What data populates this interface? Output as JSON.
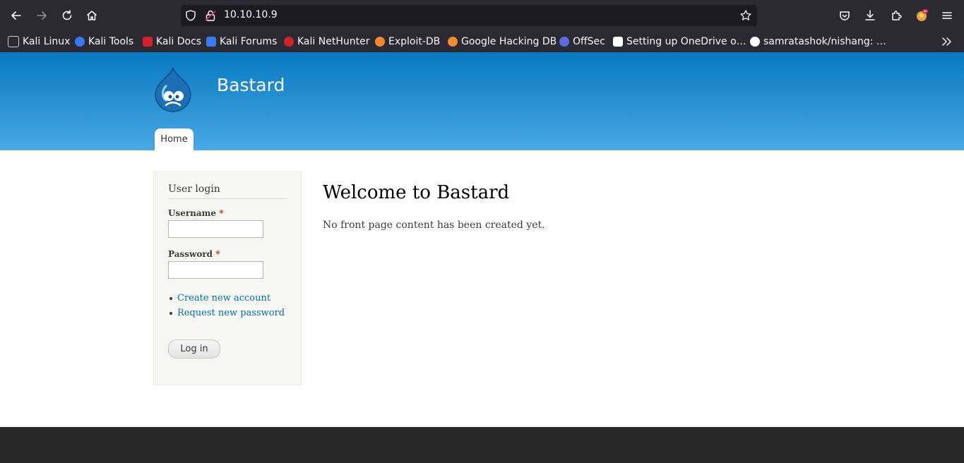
{
  "browser": {
    "url": "10.10.10.9",
    "bookmarks": [
      {
        "label": "Kali Linux",
        "color": "#1a1a1a"
      },
      {
        "label": "Kali Tools",
        "color": "#367bf0"
      },
      {
        "label": "Kali Docs",
        "color": "#d3232a"
      },
      {
        "label": "Kali Forums",
        "color": "#367bf0"
      },
      {
        "label": "Kali NetHunter",
        "color": "#d3232a"
      },
      {
        "label": "Exploit-DB",
        "color": "#f28a30"
      },
      {
        "label": "Google Hacking DB",
        "color": "#f28a30"
      },
      {
        "label": "OffSec",
        "color": "#5a6ee0"
      },
      {
        "label": "Setting up OneDrive o…",
        "color": "#ffffff"
      },
      {
        "label": "samratashok/nishang: …",
        "color": "#ffffff"
      }
    ]
  },
  "site": {
    "name": "Bastard",
    "nav": {
      "home": "Home"
    },
    "header_colors": [
      "#0779bf",
      "#48a9e4"
    ]
  },
  "login_block": {
    "title": "User login",
    "username_label": "Username",
    "password_label": "Password",
    "required_mark": "*",
    "username_value": "",
    "password_value": "",
    "links": [
      "Create new account",
      "Request new password"
    ],
    "submit_label": "Log in"
  },
  "main": {
    "title": "Welcome to Bastard",
    "text": "No front page content has been created yet."
  }
}
